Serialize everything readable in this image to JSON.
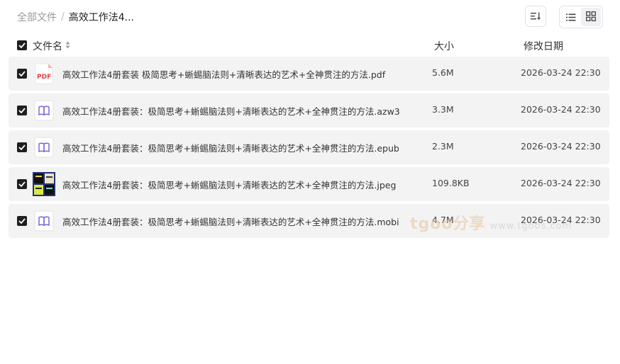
{
  "breadcrumb": {
    "root": "全部文件",
    "separator": "/",
    "current": "高效工作法4..."
  },
  "toolbar": {
    "sort_icon": "sort-icon",
    "list_view_icon": "list-view-icon",
    "grid_view_icon": "grid-view-icon"
  },
  "table": {
    "columns": {
      "name": "文件名",
      "size": "大小",
      "date": "修改日期"
    },
    "rows": [
      {
        "name": "高效工作法4册套装 极简思考+蜥蜴脑法则+清晰表达的艺术+全神贯注的方法.pdf",
        "size": "5.6M",
        "date": "2026-03-24 22:30",
        "icon": "pdf-icon",
        "icon_text": "PDF"
      },
      {
        "name": "高效工作法4册套装：极简思考+蜥蜴脑法则+清晰表达的艺术+全神贯注的方法.azw3",
        "size": "3.3M",
        "date": "2026-03-24 22:30",
        "icon": "ebook-icon"
      },
      {
        "name": "高效工作法4册套装：极简思考+蜥蜴脑法则+清晰表达的艺术+全神贯注的方法.epub",
        "size": "2.3M",
        "date": "2026-03-24 22:30",
        "icon": "ebook-icon"
      },
      {
        "name": "高效工作法4册套装：极简思考+蜥蜴脑法则+清晰表达的艺术+全神贯注的方法.jpeg",
        "size": "109.8KB",
        "date": "2026-03-24 22:30",
        "icon": "image-thumbnail"
      },
      {
        "name": "高效工作法4册套装：极简思考+蜥蜴脑法则+清晰表达的艺术+全神贯注的方法.mobi",
        "size": "4.7M",
        "date": "2026-03-24 22:30",
        "icon": "ebook-icon"
      }
    ]
  },
  "watermark": {
    "brand": "tgoo分享",
    "url": "www.tgoos.com"
  },
  "colors": {
    "row_bg": "#f3f3f4",
    "pdf_red": "#e5423b",
    "ebook_purple": "#7b5cd6",
    "checkbox": "#1f1f1f"
  }
}
